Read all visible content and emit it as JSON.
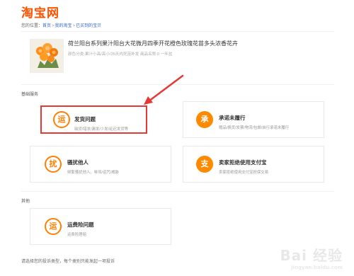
{
  "header": {
    "logo_text": "淘宝网"
  },
  "breadcrumb": {
    "prefix": "您的位置：",
    "items": [
      "首页",
      "我的淘宝",
      "已买到的宝贝"
    ],
    "separator": ">"
  },
  "product": {
    "title": "荷兰阳台系列果汁阳台大花微月四季开花橙色玫瑰花苗多头浓香花卉",
    "meta": "颜色分类:果汁小高/高小/35天内死苗补发  商品名称:0  一年盆"
  },
  "sections": {
    "basic": {
      "label": "基础服务",
      "cards": [
        {
          "icon_char": "运",
          "icon_name": "yun-icon",
          "title": "发货问题",
          "desc": "缺货/错发/漏发/少发/延迟发货等",
          "selected": true
        },
        {
          "icon_char": "承",
          "icon_name": "cheng-icon",
          "title": "承诺未履行",
          "desc": "赠品/换货/发票/物流/包邮/自行承诺未履行",
          "selected": false
        },
        {
          "icon_char": "扰",
          "icon_name": "rao-icon",
          "title": "骚扰他人",
          "desc": "频繁骚扰他人、辱骂/诅咒/威胁",
          "selected": false
        },
        {
          "icon_char": "支",
          "icon_name": "zhi-icon",
          "title": "卖家拒绝使用支付宝",
          "desc": "卖家拒绝使用支付宝担保交易",
          "selected": false
        }
      ]
    },
    "other": {
      "label": "其他",
      "cards": [
        {
          "icon_char": "运",
          "icon_name": "yun-icon",
          "title": "运费险问题",
          "desc": "运费险理赔",
          "selected": false
        }
      ]
    }
  },
  "footer": {
    "note": "请选择您的投诉类型，每个类别只能发起一项投诉"
  },
  "watermark": {
    "text": "Bai 经验",
    "sub": "jingyan.baidu.com"
  },
  "colors": {
    "accent": "#ff5000",
    "icon": "#ff7f00",
    "highlight": "#e53935",
    "link": "#3366cc"
  }
}
